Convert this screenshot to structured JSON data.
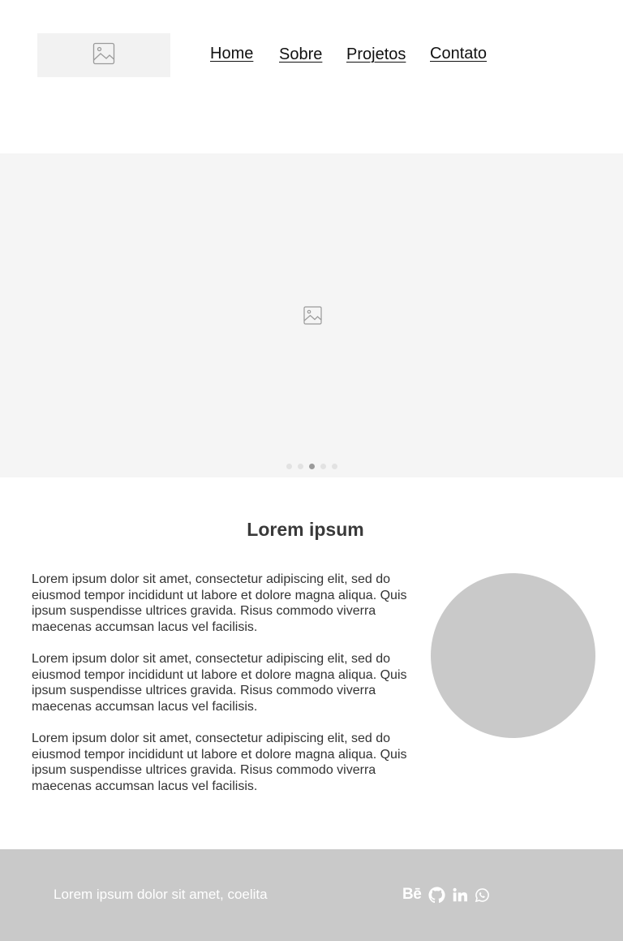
{
  "header": {
    "nav": {
      "home": "Home",
      "sobre": "Sobre",
      "projetos": "Projetos",
      "contato": "Contato"
    }
  },
  "hero": {
    "slide_count": 5,
    "active_slide": 3
  },
  "about": {
    "title": "Lorem ipsum",
    "paragraphs": [
      "Lorem ipsum dolor sit amet, consectetur adipiscing elit, sed do eiusmod tempor incididunt ut labore et dolore magna aliqua. Quis ipsum suspendisse ultrices gravida. Risus commodo viverra maecenas accumsan lacus vel facilisis.",
      "Lorem ipsum dolor sit amet, consectetur adipiscing elit, sed do eiusmod tempor incididunt ut labore et dolore magna aliqua. Quis ipsum suspendisse ultrices gravida. Risus commodo viverra maecenas accumsan lacus vel facilisis.",
      "Lorem ipsum dolor sit amet, consectetur adipiscing elit, sed do eiusmod tempor incididunt ut labore et dolore magna aliqua. Quis ipsum suspendisse ultrices gravida. Risus commodo viverra maecenas accumsan lacus vel facilisis."
    ]
  },
  "footer": {
    "text": "Lorem ipsum dolor sit amet, coelita",
    "social": {
      "behance_label": "Bē",
      "icons": [
        "behance-icon",
        "github-icon",
        "linkedin-icon",
        "whatsapp-icon"
      ]
    }
  },
  "colors": {
    "placeholder_bg": "#f5f5f5",
    "circle": "#c9c9c9",
    "footer_bg": "#c9c9c9",
    "footer_text": "#ffffff",
    "dot_active": "#9a9a9a",
    "dot_inactive": "#e2e2e2"
  }
}
